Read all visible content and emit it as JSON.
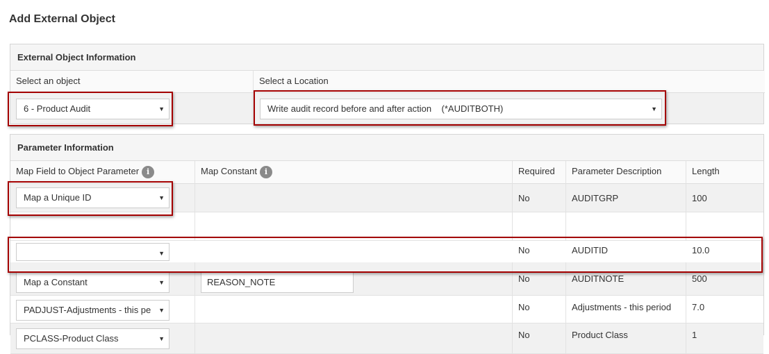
{
  "page_title": "Add External Object",
  "external_object": {
    "section_title": "External Object Information",
    "object_label": "Select an object",
    "object_value": "6 - Product Audit",
    "location_label": "Select a Location",
    "location_value": "Write audit record before and after action    (*AUDITBOTH)"
  },
  "parameters": {
    "section_title": "Parameter Information",
    "headers": {
      "map_field": "Map Field to Object Parameter",
      "map_constant": "Map Constant",
      "required": "Required",
      "description": "Parameter Description",
      "length": "Length"
    },
    "info_icon_glyph": "i",
    "rows": [
      {
        "map_field": "Map a Unique ID",
        "map_constant": "",
        "required": "No",
        "description": "AUDITGRP",
        "length": "100"
      },
      {
        "map_field": "",
        "map_constant": "",
        "required": "No",
        "description": "AUDITID",
        "length": "10.0"
      },
      {
        "map_field": "Map a Constant",
        "map_constant": "REASON_NOTE",
        "required": "No",
        "description": "AUDITNOTE",
        "length": "500"
      },
      {
        "map_field": "PADJUST-Adjustments - this pe",
        "map_constant": "",
        "required": "No",
        "description": "Adjustments - this period",
        "length": "7.0"
      },
      {
        "map_field": "PCLASS-Product Class",
        "map_constant": "",
        "required": "No",
        "description": "Product Class",
        "length": "1"
      }
    ]
  },
  "caret_glyph": "▼",
  "highlight_color": "#a40000"
}
